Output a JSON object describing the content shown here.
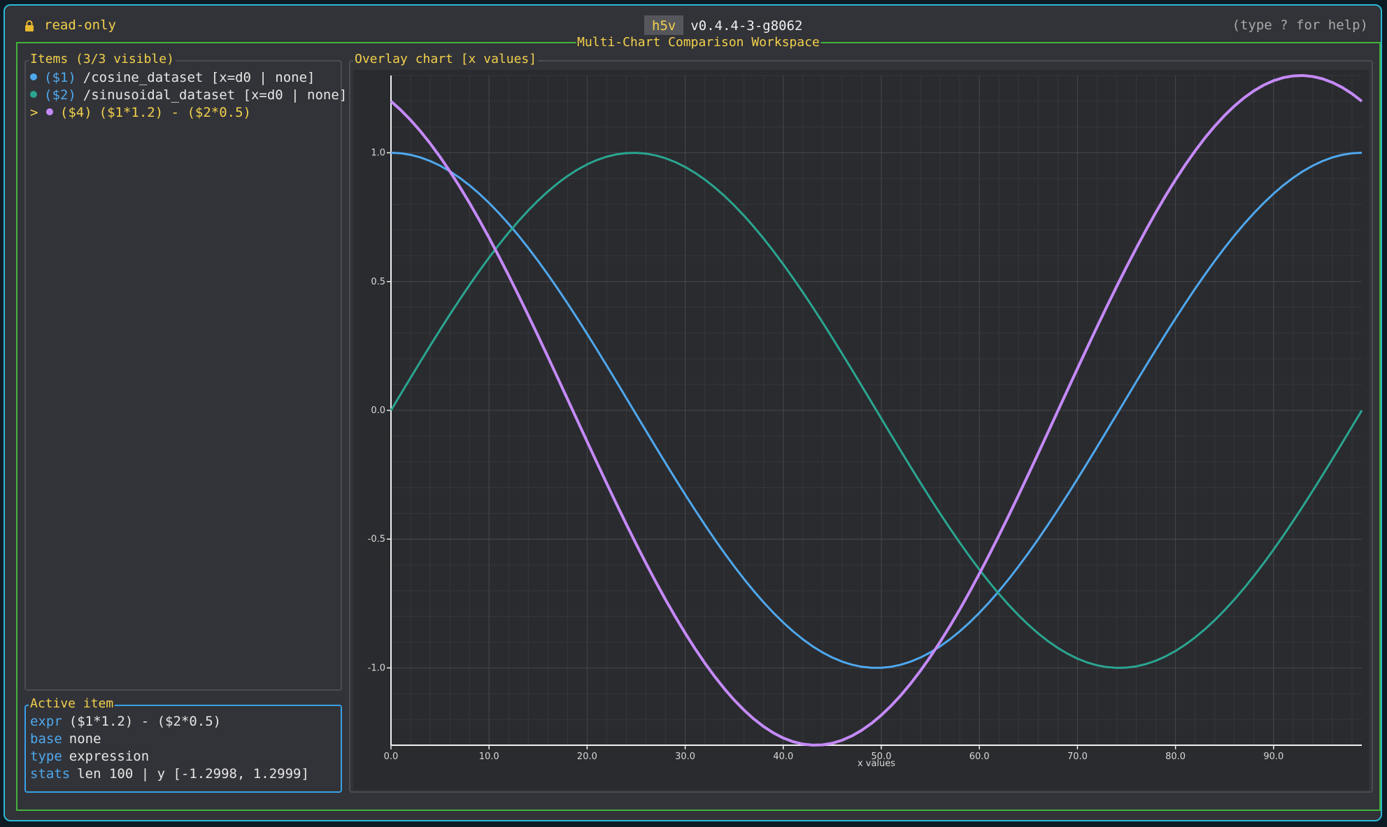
{
  "topbar": {
    "lock_label": "read-only",
    "app_name": "h5v",
    "version": "v0.4.4-3-g8062",
    "help_hint": "(type ? for help)"
  },
  "workspace": {
    "title": "Multi-Chart Comparison Workspace"
  },
  "items_panel": {
    "title": "Items (3/3 visible)",
    "items": [
      {
        "marker": "",
        "id": "($1)",
        "label": "/cosine_dataset [x=d0 | none]",
        "color": "#4fa8ee",
        "selected": false
      },
      {
        "marker": "",
        "id": "($2)",
        "label": "/sinusoidal_dataset [x=d0 | none]",
        "color": "#2aa590",
        "selected": false
      },
      {
        "marker": ">",
        "id": "($4)",
        "label": "($1*1.2) - ($2*0.5)",
        "color": "#c58af9",
        "selected": true
      }
    ]
  },
  "active_item": {
    "title": "Active item",
    "rows": [
      {
        "key": "expr",
        "value": "($1*1.2) - ($2*0.5)"
      },
      {
        "key": "base",
        "value": "none"
      },
      {
        "key": "type",
        "value": "expression"
      },
      {
        "key": "stats",
        "value": "len 100 | y [-1.2998, 1.2999]"
      }
    ]
  },
  "chart_panel": {
    "title": "Overlay chart [x values]"
  },
  "chart_data": {
    "type": "line",
    "title": "Overlay chart [x values]",
    "xlabel": "x values",
    "ylabel": "",
    "xlim": [
      0,
      99
    ],
    "ylim": [
      -1.3,
      1.3
    ],
    "x_ticks": [
      0,
      10,
      20,
      30,
      40,
      50,
      60,
      70,
      80,
      90
    ],
    "x_tick_labels": [
      "0.0",
      "10.0",
      "20.0",
      "30.0",
      "40.0",
      "50.0",
      "60.0",
      "70.0",
      "80.0",
      "90.0"
    ],
    "y_ticks": [
      1.0,
      0.5,
      0.0,
      -0.5,
      -1.0
    ],
    "y_tick_labels": [
      "1.0",
      "0.5",
      "0.0",
      "-0.5",
      "-1.0"
    ],
    "grid": true,
    "colors": {
      "cosine": "#4fa8ee",
      "sinusoidal": "#2aa590",
      "expression": "#c58af9"
    },
    "series": [
      {
        "key": "cosine",
        "period": 99,
        "formula": "cos",
        "color": "#4fa8ee"
      },
      {
        "key": "sinusoidal",
        "period": 99,
        "formula": "sin",
        "color": "#2aa590"
      },
      {
        "key": "expression",
        "period": 99,
        "formula": "1.2*cos - 0.5*sin",
        "color": "#c58af9"
      }
    ],
    "points": 100
  }
}
